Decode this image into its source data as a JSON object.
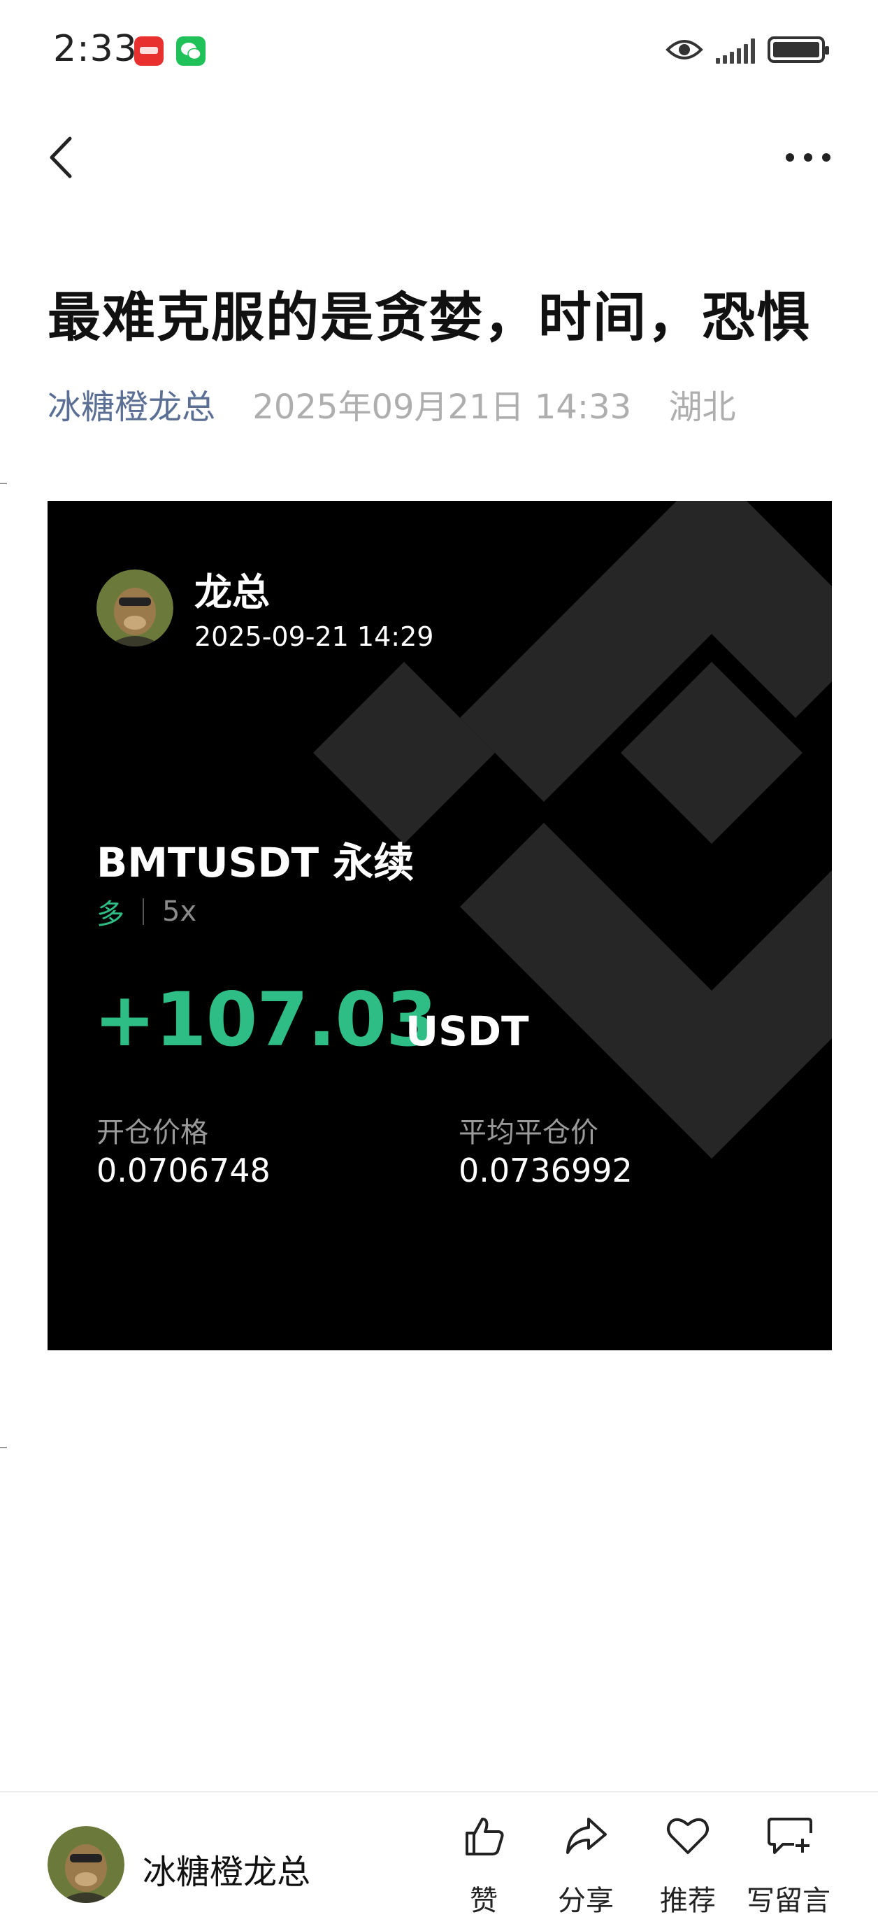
{
  "status_bar": {
    "time": "2:33",
    "notification_icons": [
      "huawei-appgallery-icon",
      "wechat-icon"
    ],
    "right_icons": [
      "eye-icon",
      "signal-icon",
      "battery-icon"
    ]
  },
  "nav": {
    "back_icon": "chevron-left-icon",
    "more_icon": "more-dots-icon"
  },
  "article": {
    "title": "最难克服的是贪婪，时间，恐惧",
    "author": "冰糖橙龙总",
    "date": "2025年09月21日 14:33",
    "location": "湖北"
  },
  "card": {
    "user_name": "龙总",
    "timestamp": "2025-09-21 14:29",
    "pair": "BMTUSDT 永续",
    "side": "多",
    "leverage": "5x",
    "pnl": "+107.03",
    "pnl_unit": "USDT",
    "entry_price_label": "开仓价格",
    "entry_price": "0.0706748",
    "avg_close_label": "平均平仓价",
    "avg_close": "0.0736992",
    "colors": {
      "profit": "#2ebd85",
      "background": "#000000"
    }
  },
  "bottom_bar": {
    "author": "冰糖橙龙总",
    "actions": [
      {
        "label": "赞",
        "icon": "thumbs-up-icon"
      },
      {
        "label": "分享",
        "icon": "share-icon"
      },
      {
        "label": "推荐",
        "icon": "heart-icon"
      },
      {
        "label": "写留言",
        "icon": "comment-add-icon"
      }
    ]
  }
}
